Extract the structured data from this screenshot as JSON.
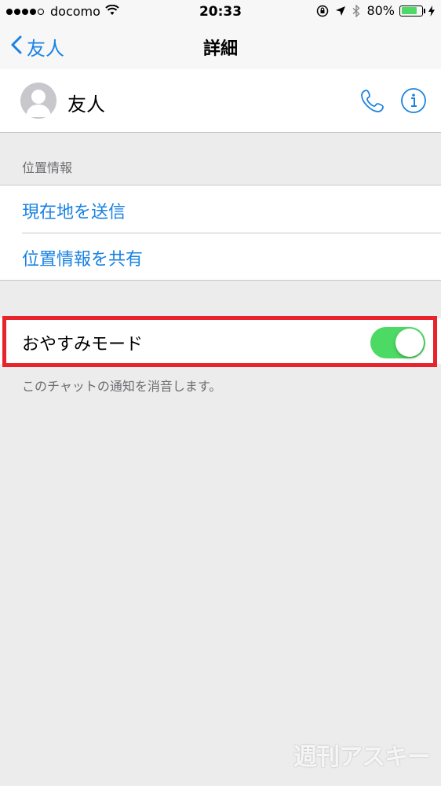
{
  "status_bar": {
    "carrier": "docomo",
    "time": "20:33",
    "battery": "80%",
    "battery_level": 0.8,
    "signal_bars": 4,
    "signal_total": 5
  },
  "nav": {
    "back_label": "友人",
    "title": "詳細"
  },
  "contact": {
    "name": "友人"
  },
  "location": {
    "header": "位置情報",
    "items": [
      {
        "label": "現在地を送信"
      },
      {
        "label": "位置情報を共有"
      }
    ]
  },
  "dnd": {
    "label": "おやすみモード",
    "enabled": true,
    "footer": "このチャットの通知を消音します。"
  },
  "watermark": "週刊アスキー",
  "colors": {
    "accent": "#1a82e2",
    "toggle_on": "#4cd964",
    "highlight": "#e8232c"
  }
}
